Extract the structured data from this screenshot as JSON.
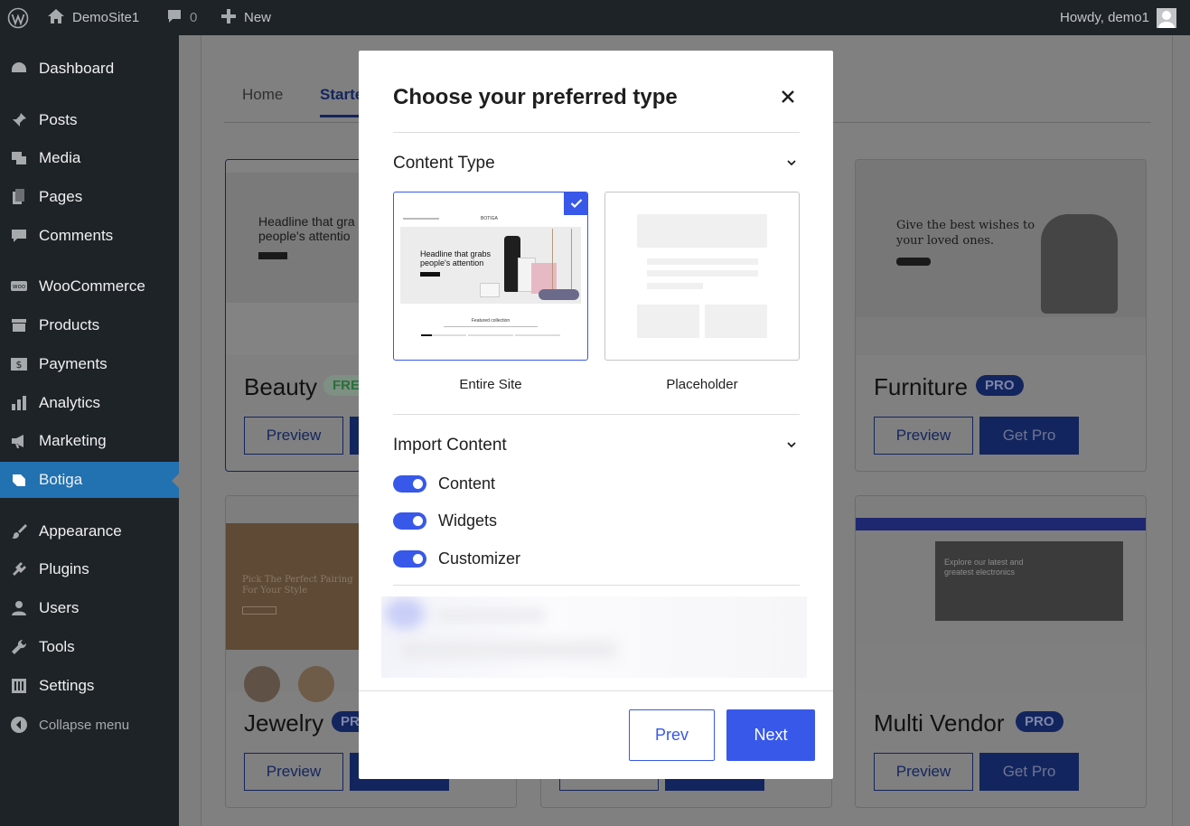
{
  "admin_bar": {
    "site_name": "DemoSite1",
    "comments_count": "0",
    "new_label": "New",
    "greeting": "Howdy, demo1"
  },
  "sidebar": {
    "items": [
      {
        "label": "Dashboard",
        "icon": "dashboard-icon"
      },
      {
        "label": "Posts",
        "icon": "pin-icon"
      },
      {
        "label": "Media",
        "icon": "media-icon"
      },
      {
        "label": "Pages",
        "icon": "pages-icon"
      },
      {
        "label": "Comments",
        "icon": "comment-icon"
      },
      {
        "label": "WooCommerce",
        "icon": "woo-icon"
      },
      {
        "label": "Products",
        "icon": "archive-icon"
      },
      {
        "label": "Payments",
        "icon": "dollar-icon"
      },
      {
        "label": "Analytics",
        "icon": "chart-icon"
      },
      {
        "label": "Marketing",
        "icon": "megaphone-icon"
      },
      {
        "label": "Botiga",
        "icon": "botiga-icon"
      },
      {
        "label": "Appearance",
        "icon": "brush-icon"
      },
      {
        "label": "Plugins",
        "icon": "plugin-icon"
      },
      {
        "label": "Users",
        "icon": "user-icon"
      },
      {
        "label": "Tools",
        "icon": "wrench-icon"
      },
      {
        "label": "Settings",
        "icon": "settings-icon"
      }
    ],
    "active_item": "Botiga",
    "collapse_label": "Collapse menu"
  },
  "background": {
    "tabs": [
      "Home",
      "Starte"
    ],
    "cards": [
      {
        "name": "Beauty",
        "badge": "FRE",
        "preview": "Preview",
        "action": "",
        "thumb_headline": "Headline that gra people's attentio"
      },
      {
        "name": "Furniture",
        "badge": "PRO",
        "preview": "Preview",
        "action": "Get Pro",
        "thumb_headline": "Give the best wishes to your loved ones."
      },
      {
        "name": "Jewelry",
        "badge": "PR",
        "preview": "Preview",
        "action": "",
        "thumb_headline": "Pick The Perfect Pairing For Your Style"
      },
      {
        "name": "Multi Vendor",
        "badge": "PRO",
        "preview": "Preview",
        "action": "Get Pro",
        "thumb_headline": "Explore our latest and greatest electronics"
      }
    ]
  },
  "modal": {
    "title": "Choose your preferred type",
    "content_type": {
      "heading": "Content Type",
      "options": [
        {
          "label": "Entire Site",
          "selected": true,
          "thumb_headline": "Headline that grabs people's attention",
          "thumb_caption": "Featured collection",
          "thumb_logo": "BOTIGA"
        },
        {
          "label": "Placeholder",
          "selected": false
        }
      ]
    },
    "import_content": {
      "heading": "Import Content",
      "toggles": [
        {
          "label": "Content",
          "on": true
        },
        {
          "label": "Widgets",
          "on": true
        },
        {
          "label": "Customizer",
          "on": true
        }
      ]
    },
    "buttons": {
      "prev": "Prev",
      "next": "Next"
    },
    "accent_color": "#3858e9"
  }
}
